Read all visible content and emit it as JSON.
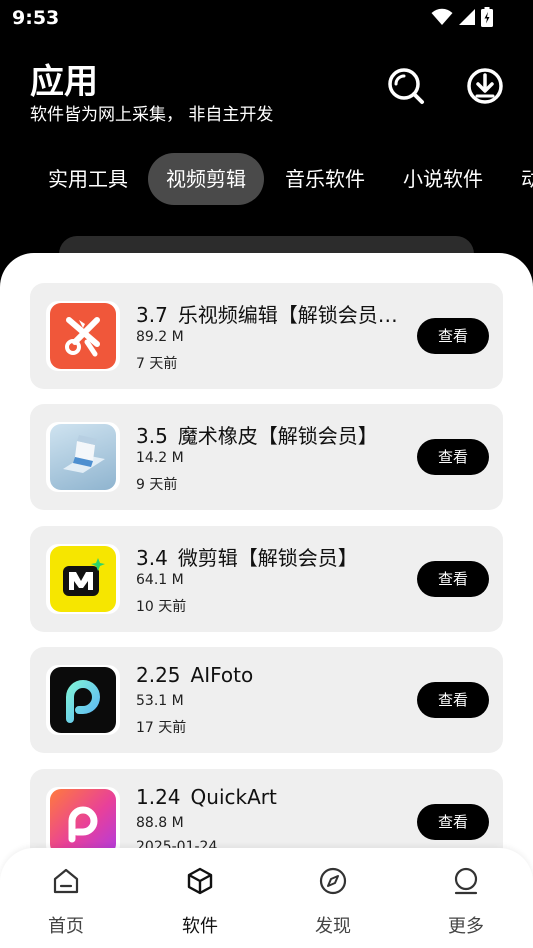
{
  "status": {
    "time": "9:53"
  },
  "header": {
    "title": "应用",
    "subtitle": "软件皆为网上采集， 非自主开发"
  },
  "tabs": [
    {
      "label": "实用工具",
      "active": false
    },
    {
      "label": "视频剪辑",
      "active": true
    },
    {
      "label": "音乐软件",
      "active": false
    },
    {
      "label": "小说软件",
      "active": false
    },
    {
      "label": "动",
      "active": false
    }
  ],
  "apps": [
    {
      "version": "3.7",
      "name": "乐视频编辑【解锁会员…",
      "size": "89.2 M",
      "date": "7 天前",
      "button": "查看",
      "icon": "scissors-icon"
    },
    {
      "version": "3.5",
      "name": "魔术橡皮【解锁会员】",
      "size": "14.2 M",
      "date": "9 天前",
      "button": "查看",
      "icon": "eraser-icon"
    },
    {
      "version": "3.4",
      "name": "微剪辑【解锁会员】",
      "size": "64.1 M",
      "date": "10 天前",
      "button": "查看",
      "icon": "m-logo-icon"
    },
    {
      "version": "2.25",
      "name": "AIFoto",
      "size": "53.1 M",
      "date": "17 天前",
      "button": "查看",
      "icon": "p-logo-icon"
    },
    {
      "version": "1.24",
      "name": "QuickArt",
      "size": "88.8 M",
      "date": "2025-01-24",
      "button": "查看",
      "icon": "quickart-icon"
    }
  ],
  "nav": [
    {
      "label": "首页",
      "icon": "home-icon"
    },
    {
      "label": "软件",
      "icon": "cube-icon"
    },
    {
      "label": "发现",
      "icon": "compass-icon"
    },
    {
      "label": "更多",
      "icon": "more-icon"
    }
  ],
  "colors": {
    "background": "#000000",
    "active_tab": "#4a4a4a",
    "card": "#efefef",
    "button": "#000000",
    "icon_orange": "#f0573a",
    "icon_yellow": "#f6e600",
    "icon_pink": "#e8409a"
  }
}
